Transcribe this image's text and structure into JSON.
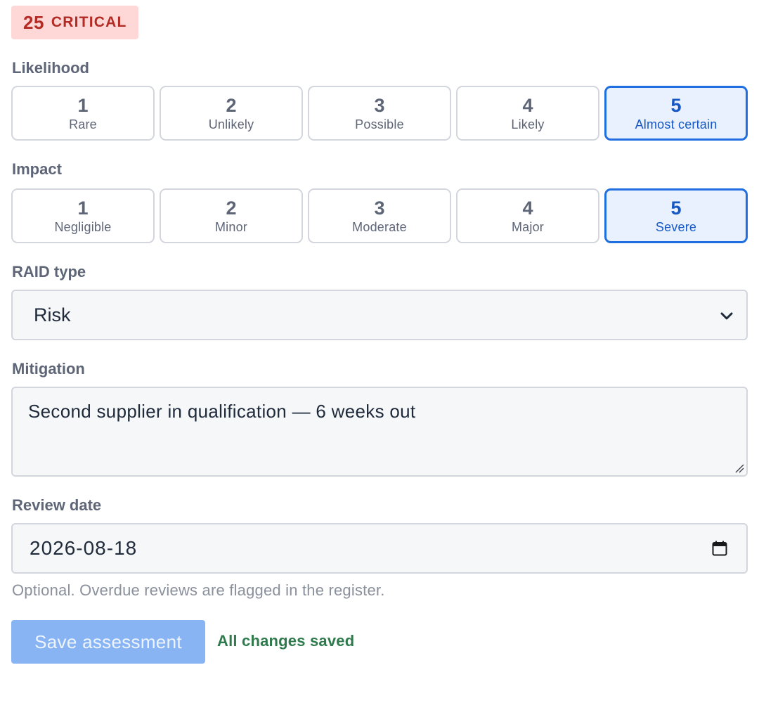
{
  "score": {
    "value": "25",
    "level": "CRITICAL",
    "color": "#b42b25",
    "background": "#fdd8d6"
  },
  "likelihood": {
    "label": "Likelihood",
    "selected": 5,
    "options": [
      {
        "value": "1",
        "label": "Rare"
      },
      {
        "value": "2",
        "label": "Unlikely"
      },
      {
        "value": "3",
        "label": "Possible"
      },
      {
        "value": "4",
        "label": "Likely"
      },
      {
        "value": "5",
        "label": "Almost certain"
      }
    ]
  },
  "impact": {
    "label": "Impact",
    "selected": 5,
    "options": [
      {
        "value": "1",
        "label": "Negligible"
      },
      {
        "value": "2",
        "label": "Minor"
      },
      {
        "value": "3",
        "label": "Moderate"
      },
      {
        "value": "4",
        "label": "Major"
      },
      {
        "value": "5",
        "label": "Severe"
      }
    ]
  },
  "raid_type": {
    "label": "RAID type",
    "value": "Risk",
    "icon": "chevron-down-icon"
  },
  "mitigation": {
    "label": "Mitigation",
    "value": "Second supplier in qualification — 6 weeks out"
  },
  "review_date": {
    "label": "Review date",
    "value": "2026-08-18",
    "icon": "calendar-icon",
    "help": "Optional. Overdue reviews are flagged in the register."
  },
  "actions": {
    "save_label": "Save assessment",
    "status": "All changes saved"
  },
  "colors": {
    "accent": "#1f6fe0",
    "selected_bg": "#e8f1fd",
    "button_disabled": "#88b4f3",
    "success": "#2f7a4c"
  }
}
